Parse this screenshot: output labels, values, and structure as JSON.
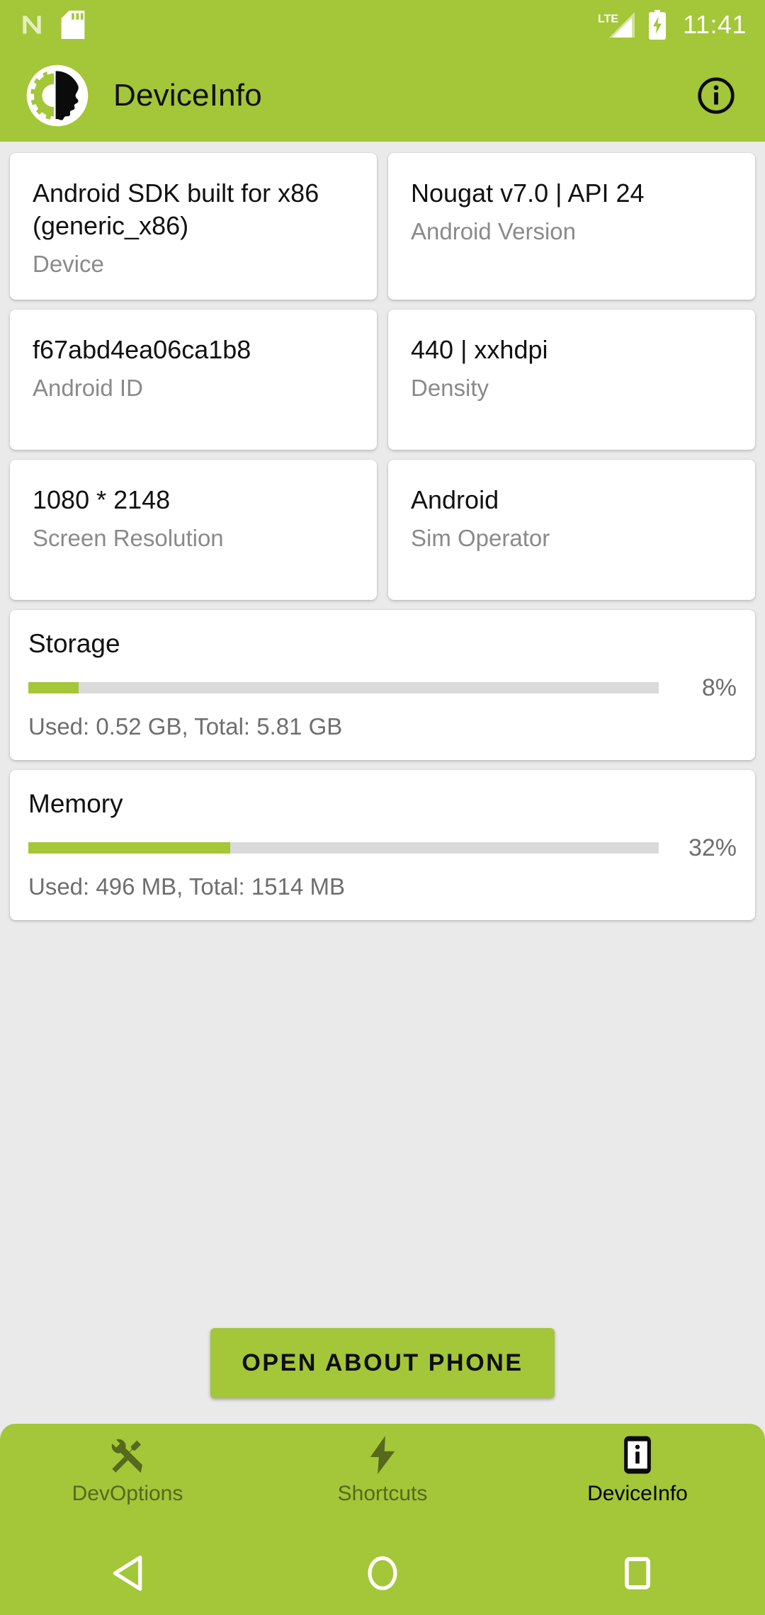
{
  "status_bar": {
    "time": "11:41",
    "icons": [
      "nougat-logo-icon",
      "sd-card-icon",
      "lte-signal-icon",
      "battery-charging-icon"
    ],
    "network_label": "LTE"
  },
  "app_bar": {
    "title": "DeviceInfo",
    "icon": "deviceinfo-app-icon",
    "action_icon": "info-circle-icon"
  },
  "colors": {
    "accent_green": "#A4C639",
    "nav_inactive": "#56691C",
    "page_background": "#EAEAEA",
    "card_background": "#FFFFFF",
    "progress_track": "#DADADA",
    "label_gray": "#8A8A8A"
  },
  "info_cards": [
    {
      "value": "Android SDK built for x86 (generic_x86)",
      "label": "Device"
    },
    {
      "value": "Nougat v7.0 | API 24",
      "label": "Android Version"
    },
    {
      "value": "f67abd4ea06ca1b8",
      "label": "Android ID"
    },
    {
      "value": "440  | xxhdpi",
      "label": "Density"
    },
    {
      "value": "1080 * 2148",
      "label": "Screen Resolution"
    },
    {
      "value": "Android",
      "label": "Sim Operator"
    }
  ],
  "progress_cards": [
    {
      "title": "Storage",
      "percent_label": "8%",
      "percent_value": 8,
      "detail": "Used: 0.52 GB, Total: 5.81 GB"
    },
    {
      "title": "Memory",
      "percent_label": "32%",
      "percent_value": 32,
      "detail": "Used: 496 MB, Total: 1514 MB"
    }
  ],
  "cta": {
    "label": "OPEN ABOUT PHONE"
  },
  "bottom_nav": {
    "items": [
      {
        "label": "DevOptions",
        "icon": "tools-icon",
        "active": false
      },
      {
        "label": "Shortcuts",
        "icon": "lightning-bolt-icon",
        "active": false
      },
      {
        "label": "DeviceInfo",
        "icon": "phone-info-icon",
        "active": true
      }
    ]
  },
  "system_nav": {
    "back": "back-triangle-icon",
    "home": "home-circle-icon",
    "recents": "recents-square-icon"
  }
}
